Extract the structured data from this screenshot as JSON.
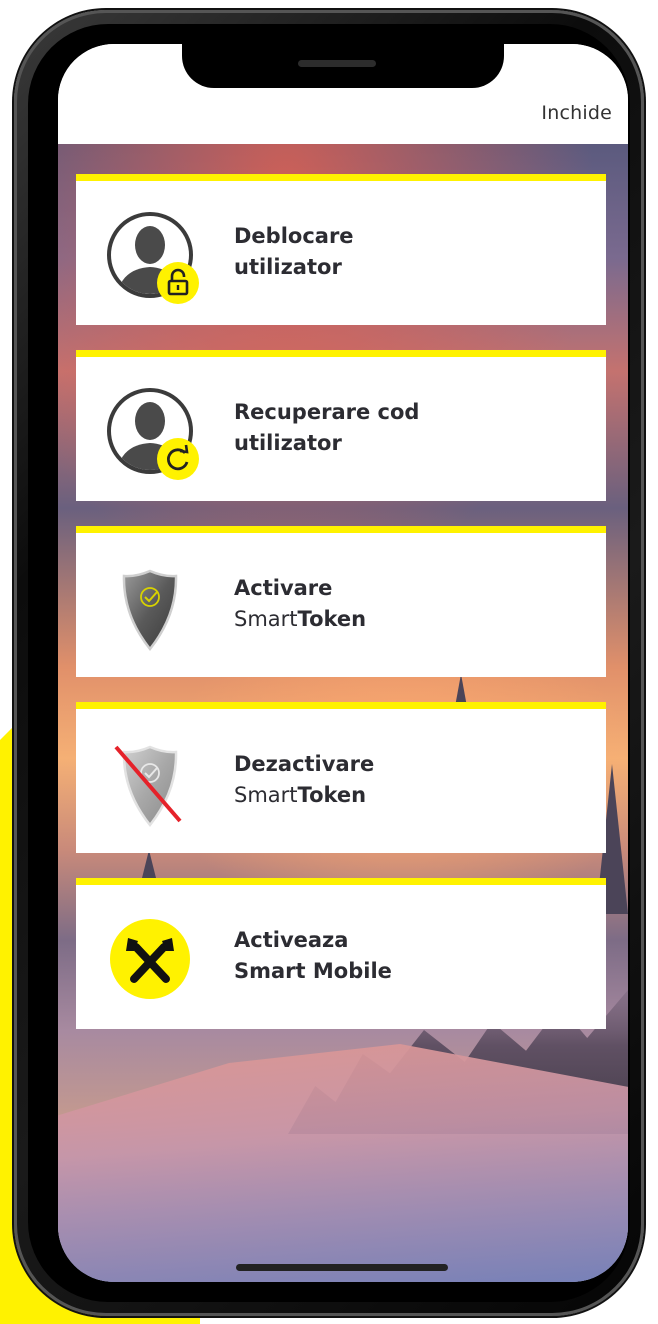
{
  "header": {
    "close_label": "Inchide"
  },
  "menu": {
    "items": [
      {
        "line1": "Deblocare",
        "line2": "utilizator",
        "icon": "user-unlock-icon"
      },
      {
        "line1": "Recuperare cod",
        "line2": "utilizator",
        "icon": "user-recover-icon"
      },
      {
        "line1": "Activare",
        "line2_prefix": "Smart",
        "line2_bold": "Token",
        "icon": "shield-check-icon"
      },
      {
        "line1": "Dezactivare",
        "line2_prefix": "Smart",
        "line2_bold": "Token",
        "icon": "shield-disabled-icon"
      },
      {
        "line1": "Activeaza",
        "line2": "Smart Mobile",
        "icon": "raiffeisen-logo-icon"
      }
    ]
  },
  "colors": {
    "accent": "#fff200",
    "text": "#2c2c32",
    "disable_red": "#e5222a"
  }
}
